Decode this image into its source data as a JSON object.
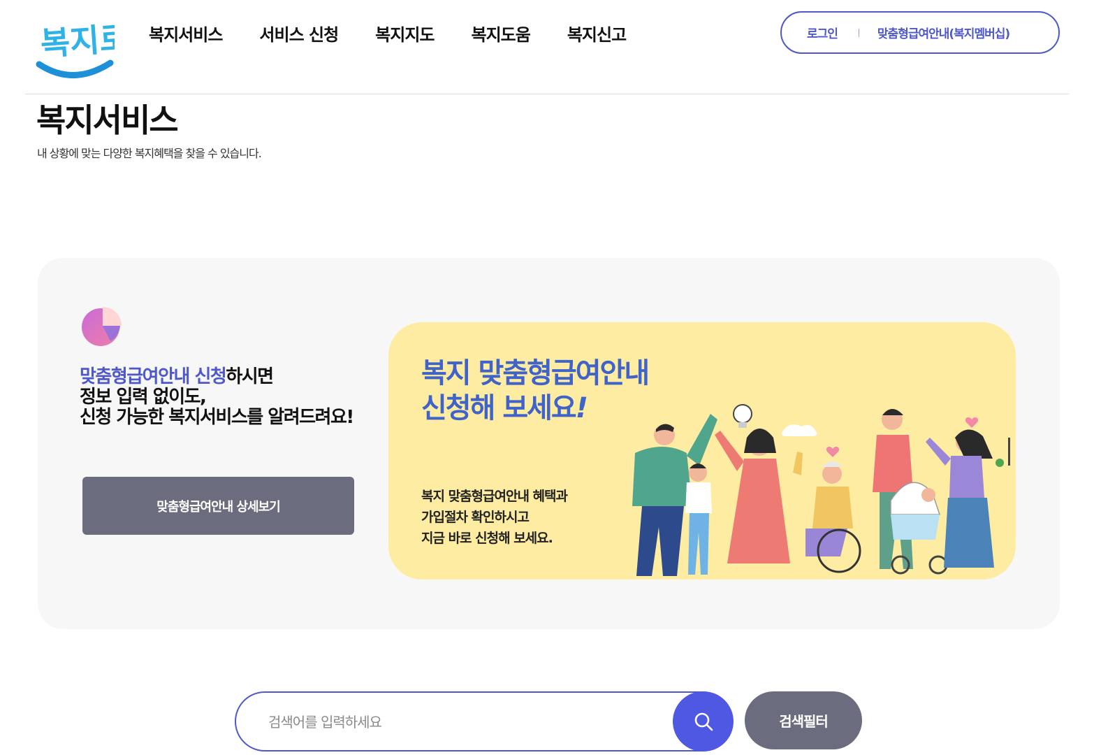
{
  "header": {
    "logo_text": "복지로",
    "nav": [
      "복지서비스",
      "서비스 신청",
      "복지지도",
      "복지도움",
      "복지신고"
    ],
    "login_label": "로그인",
    "membership_label": "맞춤형급여안내(복지멤버십)"
  },
  "page": {
    "title": "복지서비스",
    "description": "내 상황에 맞는 다양한 복지혜택을 찾을 수 있습니다."
  },
  "promo": {
    "highlight": "맞춤형급여안내 신청",
    "line1_rest": "하시면",
    "line2": "정보 입력 없이도,",
    "line3": "신청 가능한 복지서비스를 알려드려요!",
    "detail_button": "맞춤형급여안내 상세보기",
    "banner": {
      "title_line1": "복지 맞춤형급여안내",
      "title_line2": "신청해 보세요",
      "title_mark": "!",
      "desc_line1": "복지 맞춤형급여안내 혜택과",
      "desc_line2": "가입절차 확인하시고",
      "desc_line3": "지금 바로 신청해 보세요."
    }
  },
  "search": {
    "placeholder": "검색어를 입력하세요",
    "filter_button": "검색필터"
  },
  "colors": {
    "brand": "#4e58c9",
    "banner_bg": "#fdeca1",
    "banner_title": "#3f63c8",
    "button_gray": "#6b6d7f"
  }
}
